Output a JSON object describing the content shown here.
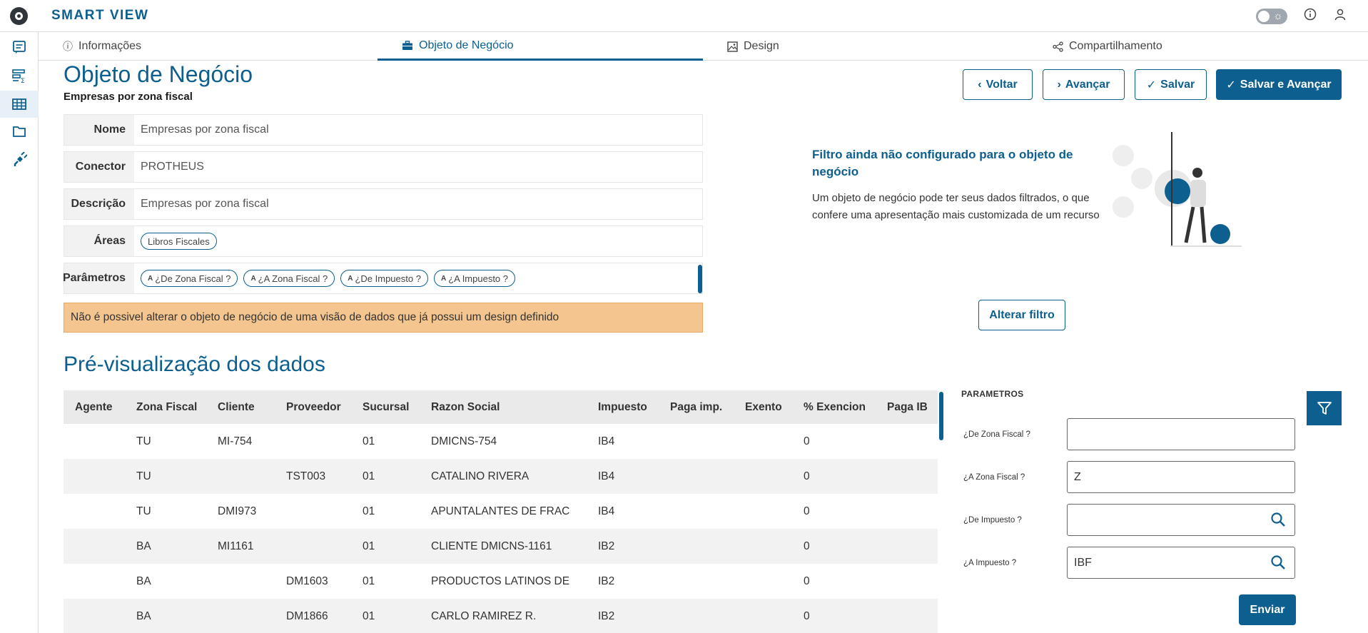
{
  "app": {
    "title": "SMART VIEW"
  },
  "tabs": [
    {
      "label": "Informações",
      "icon": "info-icon"
    },
    {
      "label": "Objeto de Negócio",
      "icon": "briefcase-icon"
    },
    {
      "label": "Design",
      "icon": "image-icon"
    },
    {
      "label": "Compartilhamento",
      "icon": "share-icon"
    }
  ],
  "page": {
    "title": "Objeto de Negócio",
    "subtitle": "Empresas por zona fiscal"
  },
  "form": {
    "nome": {
      "label": "Nome",
      "value": "Empresas por zona fiscal"
    },
    "conector": {
      "label": "Conector",
      "value": "PROTHEUS"
    },
    "descricao": {
      "label": "Descrição",
      "value": "Empresas por zona fiscal"
    },
    "areas": {
      "label": "Áreas",
      "chips": [
        "Libros Fiscales"
      ]
    },
    "parametros": {
      "label": "Parâmetros",
      "chip_icon_letter": "A",
      "chips": [
        "¿De Zona Fiscal ?",
        "¿A Zona Fiscal ?",
        "¿De Impuesto ?",
        "¿A Impuesto ?"
      ]
    }
  },
  "warning": "Não é possivel alterar o objeto de negócio de uma visão de dados que já possui um design definido",
  "actions": {
    "back": "Voltar",
    "next": "Avançar",
    "save": "Salvar",
    "save_next": "Salvar e Avançar"
  },
  "filter_empty": {
    "title": "Filtro ainda não configurado para o objeto de negócio",
    "text": "Um objeto de negócio pode ter seus dados filtrados, o que confere uma apresentação mais customizada de um recurso",
    "button": "Alterar filtro"
  },
  "preview": {
    "title": "Pré-visualização dos dados",
    "columns": [
      "Agente",
      "Zona Fiscal",
      "Cliente",
      "Proveedor",
      "Sucursal",
      "Razon Social",
      "Impuesto",
      "Paga imp.",
      "Exento",
      "% Exencion",
      "Paga IB"
    ],
    "rows": [
      [
        "",
        "TU",
        "MI-754",
        "",
        "01",
        "DMICNS-754",
        "IB4",
        "",
        "",
        "0",
        ""
      ],
      [
        "",
        "TU",
        "",
        "TST003",
        "01",
        "CATALINO RIVERA",
        "IB4",
        "",
        "",
        "0",
        ""
      ],
      [
        "",
        "TU",
        "DMI973",
        "",
        "01",
        "APUNTALANTES DE FRAC",
        "IB4",
        "",
        "",
        "0",
        ""
      ],
      [
        "",
        "BA",
        "MI1161",
        "",
        "01",
        "CLIENTE DMICNS-1161",
        "IB2",
        "",
        "",
        "0",
        ""
      ],
      [
        "",
        "BA",
        "",
        "DM1603",
        "01",
        "PRODUCTOS LATINOS DE",
        "IB2",
        "",
        "",
        "0",
        ""
      ],
      [
        "",
        "BA",
        "",
        "DM1866",
        "01",
        "CARLO RAMIREZ R.",
        "IB2",
        "",
        "",
        "0",
        ""
      ]
    ]
  },
  "parameters_panel": {
    "title": "PARAMETROS",
    "fields": [
      {
        "label": "¿De Zona Fiscal ?",
        "value": "",
        "search": false
      },
      {
        "label": "¿A Zona Fiscal ?",
        "value": "Z",
        "search": false
      },
      {
        "label": "¿De Impuesto ?",
        "value": "",
        "search": true
      },
      {
        "label": "¿A Impuesto ?",
        "value": "IBF",
        "search": true
      }
    ],
    "submit": "Enviar"
  },
  "colors": {
    "primary": "#0c5f8f",
    "warning_bg": "#f4c58f",
    "header_bg": "#eaeaea"
  }
}
